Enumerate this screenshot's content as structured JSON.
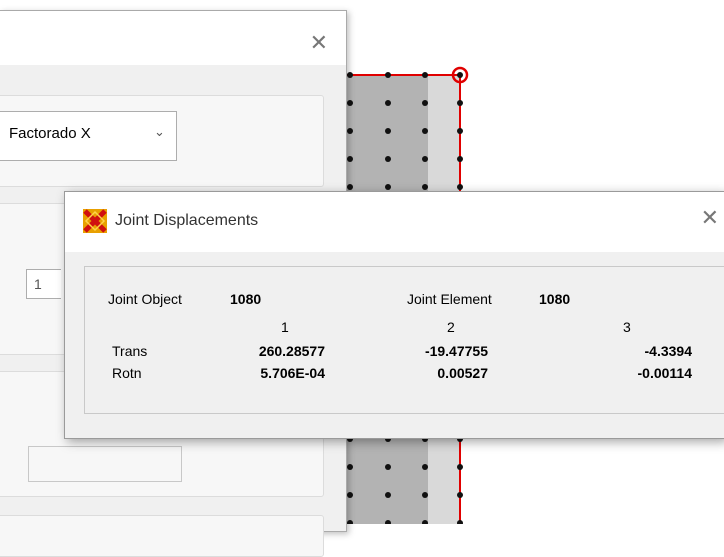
{
  "background_dialog": {
    "combo": {
      "value": "Factorado X",
      "arrow_icon": "chevron-down-icon"
    },
    "small_input": {
      "value": "1"
    },
    "close_icon": "close-icon"
  },
  "joint_displacements": {
    "title": "Joint Displacements",
    "app_icon": "sap2000-icon",
    "close_icon": "close-icon",
    "joint_object_label": "Joint  Object",
    "joint_object_value": "1080",
    "joint_element_label": "Joint Element",
    "joint_element_value": "1080",
    "columns": [
      "1",
      "2",
      "3"
    ],
    "rows": [
      {
        "label": "Trans",
        "values": [
          "260.28577",
          "-19.47755",
          "-4.3394"
        ]
      },
      {
        "label": "Rotn",
        "values": [
          "5.706E-04",
          "0.00527",
          "-0.00114"
        ]
      }
    ]
  },
  "colors": {
    "selection_red": "#e00000",
    "grid_dark": "#b0b0b0",
    "grid_light": "#d8d8d8"
  }
}
